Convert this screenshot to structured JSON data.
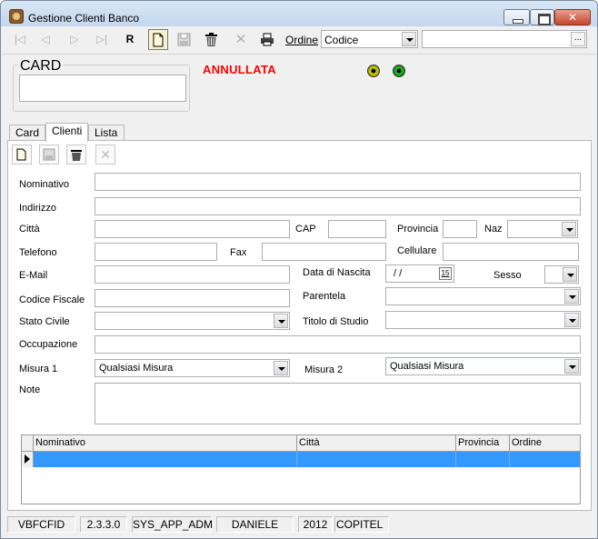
{
  "window": {
    "title": "Gestione Clienti Banco"
  },
  "toolbar": {
    "r_label": "R",
    "ordine_label": "Ordine",
    "ordine_value": "Codice",
    "search_dots": "..."
  },
  "card": {
    "legend": "CARD",
    "value": "",
    "status": "ANNULLATA"
  },
  "tabs": [
    {
      "label": "Card"
    },
    {
      "label": "Clienti"
    },
    {
      "label": "Lista"
    }
  ],
  "form": {
    "nominativo": "Nominativo",
    "indirizzo": "Indirizzo",
    "citta": "Città",
    "cap": "CAP",
    "provincia": "Provincia",
    "naz": "Naz",
    "telefono": "Telefono",
    "fax": "Fax",
    "cellulare": "Cellulare",
    "email": "E-Mail",
    "data_nascita": "Data di Nascita",
    "data_value": " /  /",
    "sesso": "Sesso",
    "codice_fiscale": "Codice Fiscale",
    "parentela": "Parentela",
    "stato_civile": "Stato Civile",
    "titolo_studio": "Titolo di Studio",
    "occupazione": "Occupazione",
    "misura1": "Misura 1",
    "misura1_value": "Qualsiasi Misura",
    "misura2": "Misura 2",
    "misura2_value": "Qualsiasi Misura",
    "note": "Note"
  },
  "grid": {
    "columns": [
      "Nominativo",
      "Città",
      "Provincia",
      "Ordine"
    ]
  },
  "statusbar": [
    "VBFCFID",
    "2.3.3.0",
    "SYS_APP_ADM",
    "DANIELE",
    "2012",
    "COPITEL"
  ]
}
